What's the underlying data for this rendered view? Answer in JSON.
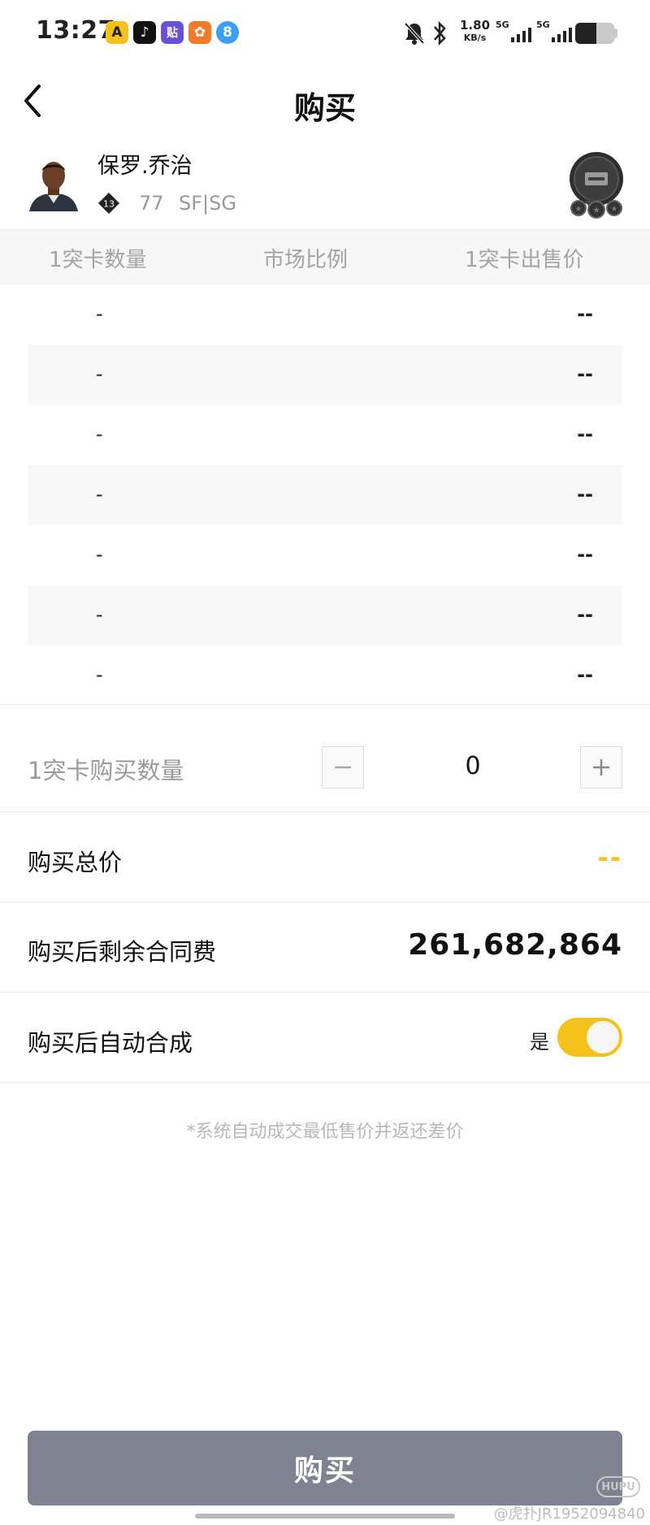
{
  "status_bar": {
    "time": "13:27",
    "net_speed": "1.80",
    "net_unit": "KB/s",
    "sim1": "5G",
    "sim2": "5G",
    "app_icons": [
      {
        "name": "app-icon-yellow",
        "glyph": "A",
        "color": "#f5c11a"
      },
      {
        "name": "tiktok-icon",
        "glyph": "♪",
        "color": "#111111"
      },
      {
        "name": "tieba-icon",
        "glyph": "贴",
        "color": "#6a4fd8"
      },
      {
        "name": "app-icon-orange",
        "glyph": "✿",
        "color": "#f27a2c"
      },
      {
        "name": "app-icon-blue",
        "glyph": "8",
        "color": "#3aa0f5"
      }
    ],
    "status_icons": [
      "mute-bell-icon",
      "bluetooth-icon",
      "signal-icon",
      "battery-icon"
    ]
  },
  "nav": {
    "title": "购买",
    "back_icon": "chevron-left-icon"
  },
  "player": {
    "name": "保罗.乔治",
    "badge_number": "13",
    "ovr": "77",
    "positions": "SF|SG"
  },
  "table": {
    "headers": [
      "1突卡数量",
      "市场比例",
      "1突卡出售价"
    ],
    "rows": [
      {
        "qty": "-",
        "price": "--"
      },
      {
        "qty": "-",
        "price": "--"
      },
      {
        "qty": "-",
        "price": "--"
      },
      {
        "qty": "-",
        "price": "--"
      },
      {
        "qty": "-",
        "price": "--"
      },
      {
        "qty": "-",
        "price": "--"
      },
      {
        "qty": "-",
        "price": "--"
      }
    ]
  },
  "purchase": {
    "qty_label": "1突卡购买数量",
    "qty_value": "0",
    "total_label": "购买总价",
    "total_value": "--",
    "remaining_label": "购买后剩余合同费",
    "remaining_value": "261,682,864",
    "auto_merge_label": "购买后自动合成",
    "auto_merge_state": "是",
    "auto_merge_on": true,
    "note": "*系统自动成交最低售价并返还差价",
    "buy_button": "购买"
  },
  "watermark": {
    "logo": "HUPU",
    "text": "@虎扑JR1952094840"
  },
  "colors": {
    "accent": "#f4c21b",
    "buy_button": "#7f8290",
    "muted_text": "#a3a3a3"
  }
}
